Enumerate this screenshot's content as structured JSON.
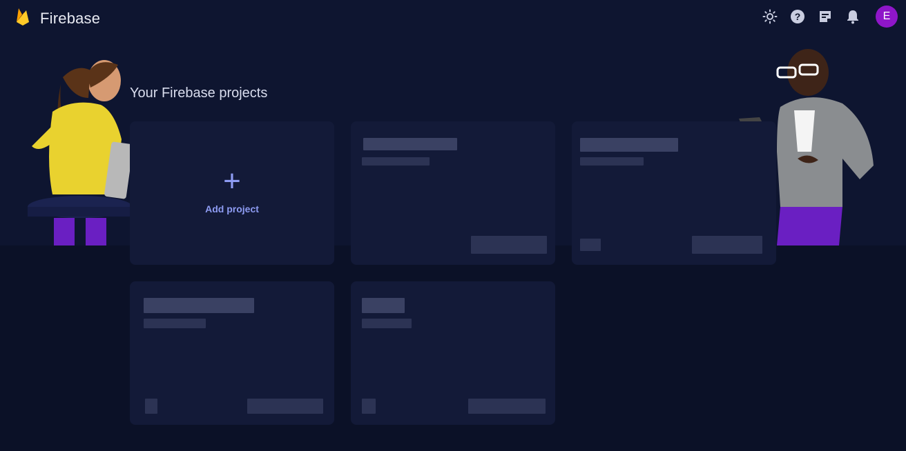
{
  "app": {
    "name": "Firebase"
  },
  "user": {
    "avatar_letter": "E"
  },
  "main": {
    "title": "Your Firebase projects"
  },
  "add_card": {
    "label": "Add project",
    "plus": "+"
  },
  "icons": {
    "logo": "firebase-flame-icon",
    "theme": "sun-icon",
    "help": "help-icon",
    "feedback": "feedback-icon",
    "notifications": "bell-icon"
  },
  "colors": {
    "accent": "#8e9cf3",
    "avatar": "#8f16c9",
    "background": "#0b1127",
    "card": "#131a38"
  }
}
